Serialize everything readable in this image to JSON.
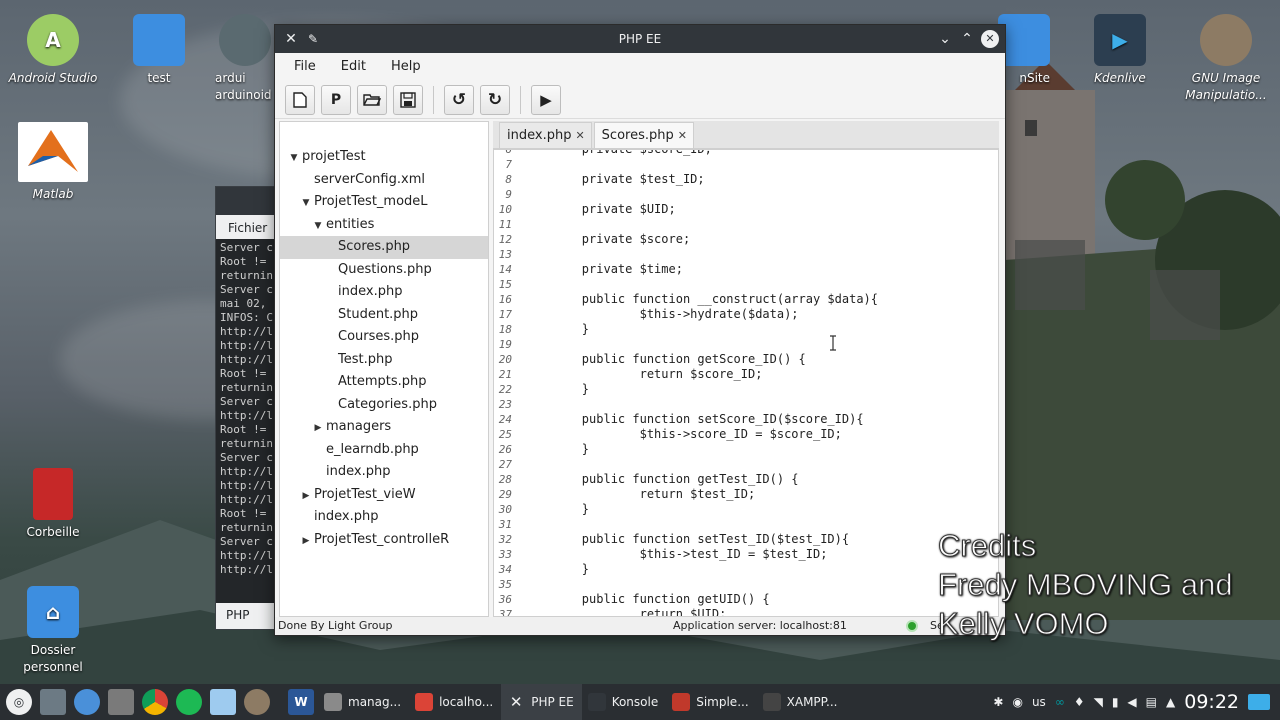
{
  "desktop": {
    "icons": [
      {
        "label": "Android Studio",
        "italic": true
      },
      {
        "label": "test",
        "italic": false
      },
      {
        "label": "ardui\narduinoid",
        "italic": false
      },
      {
        "label": "Matlab",
        "italic": true
      },
      {
        "label": "Corbeille",
        "italic": false
      },
      {
        "label": "Dossier\npersonnel",
        "italic": false
      },
      {
        "label": "nSite",
        "italic": false
      },
      {
        "label": "Kdenlive",
        "italic": true
      },
      {
        "label": "GNU Image\nManipulatio...",
        "italic": true
      }
    ]
  },
  "konsole": {
    "menu_label": "Fichier",
    "lines": [
      "Server c",
      "Root != ",
      "returnin",
      "Server c",
      "mai 02, ",
      "INFOS: C",
      "http://l",
      "http://l",
      "http://l",
      "Root != ",
      "returnin",
      "Server c",
      "http://l",
      "Root != ",
      "returnin",
      "Server c",
      "http://l",
      "http://l",
      "http://l",
      "Root != ",
      "returnin",
      "Server c",
      "http://l",
      "http://l"
    ],
    "tab_label": "PHP"
  },
  "window": {
    "title": "PHP EE",
    "menu": [
      "File",
      "Edit",
      "Help"
    ],
    "toolbar": {
      "new_label": "",
      "project_label": "P"
    }
  },
  "tree": {
    "items": [
      {
        "label": "projetTest",
        "arrow": "▼",
        "indent": 0
      },
      {
        "label": "serverConfig.xml",
        "arrow": "",
        "indent": 1
      },
      {
        "label": "ProjetTest_modeL",
        "arrow": "▼",
        "indent": 1
      },
      {
        "label": "entities",
        "arrow": "▼",
        "indent": 2
      },
      {
        "label": "Scores.php",
        "arrow": "",
        "indent": 3,
        "selected": true
      },
      {
        "label": "Questions.php",
        "arrow": "",
        "indent": 3
      },
      {
        "label": "index.php",
        "arrow": "",
        "indent": 3
      },
      {
        "label": "Student.php",
        "arrow": "",
        "indent": 3
      },
      {
        "label": "Courses.php",
        "arrow": "",
        "indent": 3
      },
      {
        "label": "Test.php",
        "arrow": "",
        "indent": 3
      },
      {
        "label": "Attempts.php",
        "arrow": "",
        "indent": 3
      },
      {
        "label": "Categories.php",
        "arrow": "",
        "indent": 3
      },
      {
        "label": "managers",
        "arrow": "▶",
        "indent": 2
      },
      {
        "label": "e_learndb.php",
        "arrow": "",
        "indent": 2
      },
      {
        "label": "index.php",
        "arrow": "",
        "indent": 2
      },
      {
        "label": "ProjetTest_vieW",
        "arrow": "▶",
        "indent": 1
      },
      {
        "label": "index.php",
        "arrow": "",
        "indent": 1
      },
      {
        "label": "ProjetTest_controlleR",
        "arrow": "▶",
        "indent": 1
      }
    ]
  },
  "editor": {
    "tabs": [
      {
        "label": "index.php",
        "active": false
      },
      {
        "label": "Scores.php",
        "active": true
      }
    ],
    "close_glyph": "✕",
    "lines": [
      {
        "n": "6",
        "t": "        private $score_ID;"
      },
      {
        "n": "7",
        "t": ""
      },
      {
        "n": "8",
        "t": "        private $test_ID;"
      },
      {
        "n": "9",
        "t": ""
      },
      {
        "n": "10",
        "t": "        private $UID;"
      },
      {
        "n": "11",
        "t": ""
      },
      {
        "n": "12",
        "t": "        private $score;"
      },
      {
        "n": "13",
        "t": ""
      },
      {
        "n": "14",
        "t": "        private $time;"
      },
      {
        "n": "15",
        "t": ""
      },
      {
        "n": "16",
        "t": "        public function __construct(array $data){"
      },
      {
        "n": "17",
        "t": "                $this->hydrate($data);"
      },
      {
        "n": "18",
        "t": "        }"
      },
      {
        "n": "19",
        "t": ""
      },
      {
        "n": "20",
        "t": "        public function getScore_ID() {"
      },
      {
        "n": "21",
        "t": "                return $score_ID;"
      },
      {
        "n": "22",
        "t": "        }"
      },
      {
        "n": "23",
        "t": ""
      },
      {
        "n": "24",
        "t": "        public function setScore_ID($score_ID){"
      },
      {
        "n": "25",
        "t": "                $this->score_ID = $score_ID;"
      },
      {
        "n": "26",
        "t": "        }"
      },
      {
        "n": "27",
        "t": ""
      },
      {
        "n": "28",
        "t": "        public function getTest_ID() {"
      },
      {
        "n": "29",
        "t": "                return $test_ID;"
      },
      {
        "n": "30",
        "t": "        }"
      },
      {
        "n": "31",
        "t": ""
      },
      {
        "n": "32",
        "t": "        public function setTest_ID($test_ID){"
      },
      {
        "n": "33",
        "t": "                $this->test_ID = $test_ID;"
      },
      {
        "n": "34",
        "t": "        }"
      },
      {
        "n": "35",
        "t": ""
      },
      {
        "n": "36",
        "t": "        public function getUID() {"
      },
      {
        "n": "37",
        "t": "                return $UID;"
      }
    ]
  },
  "status": {
    "left": "Done By Light Group",
    "server": "Application server: localhost:81",
    "right": "Se"
  },
  "credits": {
    "line1": "Credits",
    "line2": "Fredy MBOVING and",
    "line3": "Kelly VOMO"
  },
  "taskbar": {
    "tasks": [
      {
        "label": "manag...",
        "icon": "folder-icon",
        "color": "#8a8a8a"
      },
      {
        "label": "localho...",
        "icon": "chrome-icon",
        "color": "#db4437"
      },
      {
        "label": "PHP EE",
        "icon": "close-x-icon",
        "color": "#3b4045",
        "active": true
      },
      {
        "label": "Konsole",
        "icon": "terminal-icon",
        "color": "#31363b"
      },
      {
        "label": "Simple...",
        "icon": "recorder-icon",
        "color": "#c0392b"
      },
      {
        "label": "XAMPP...",
        "icon": "xampp-icon",
        "color": "#444"
      }
    ],
    "tray_lang": "us",
    "clock": "09:22"
  }
}
